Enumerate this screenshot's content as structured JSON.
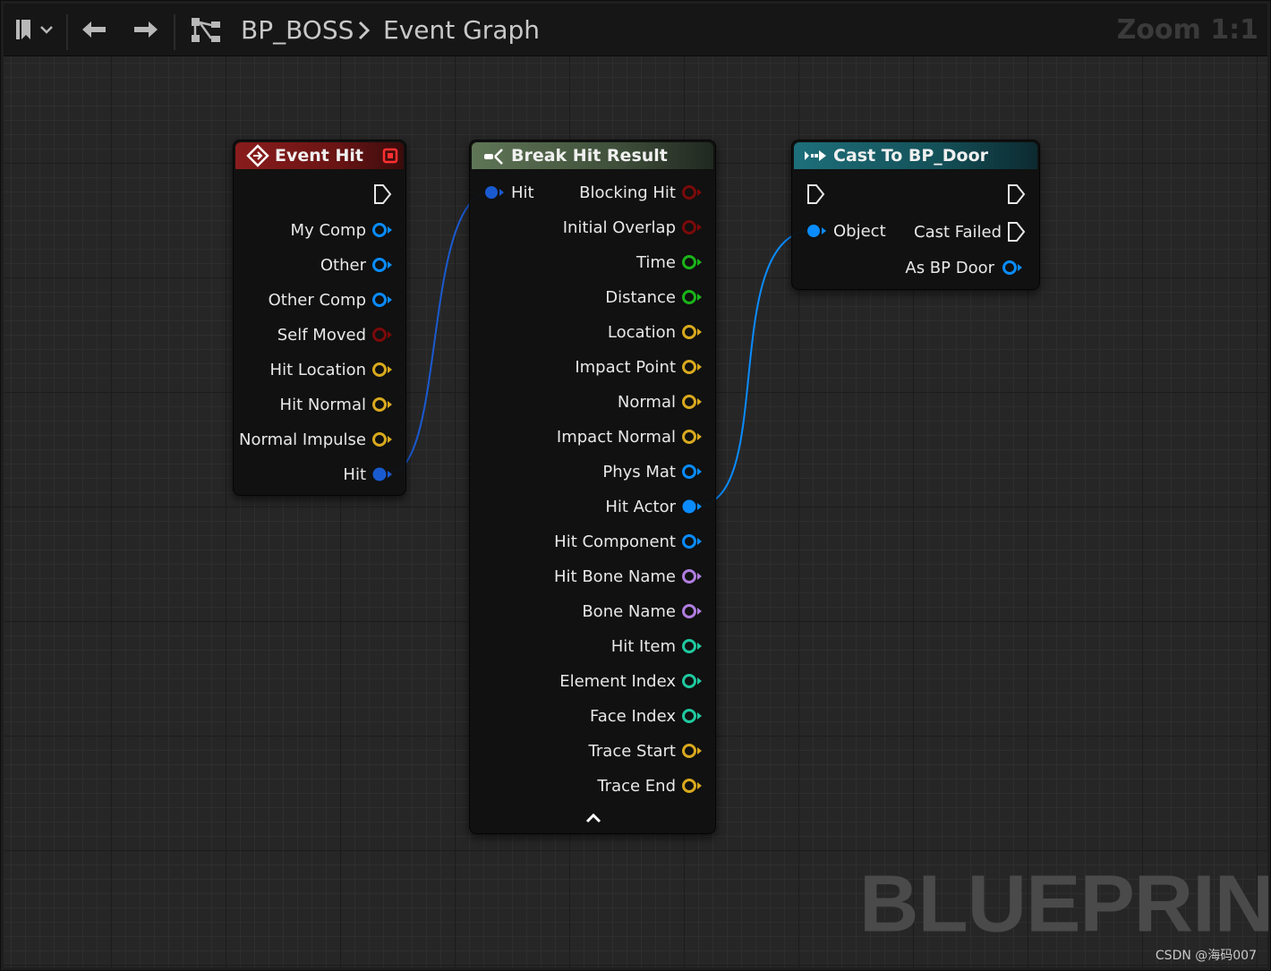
{
  "toolbar": {
    "breadcrumb": [
      "BP_BOSS",
      "Event Graph"
    ],
    "zoom": "Zoom 1:1"
  },
  "watermark": "BLUEPRINT",
  "credit": "CSDN @海码007",
  "colors": {
    "event_header": "#8a1c1c",
    "function_header": "#5f7656",
    "cast_header": "#1d6f7a",
    "object_pin": "#0a8cff",
    "struct_pin": "#1a5ad0",
    "bool_pin": "#7a0a0a",
    "float_pin": "#1ab41a",
    "vector_pin": "#d9a91e",
    "name_pin": "#b07de0",
    "int_pin": "#1fc9a0"
  },
  "nodes": {
    "event_hit": {
      "title": "Event Hit",
      "outputs": [
        "My Comp",
        "Other",
        "Other Comp",
        "Self Moved",
        "Hit Location",
        "Hit Normal",
        "Normal Impulse",
        "Hit"
      ]
    },
    "break_hit_result": {
      "title": "Break Hit Result",
      "input": "Hit",
      "outputs": [
        "Blocking Hit",
        "Initial Overlap",
        "Time",
        "Distance",
        "Location",
        "Impact Point",
        "Normal",
        "Impact Normal",
        "Phys Mat",
        "Hit Actor",
        "Hit Component",
        "Hit Bone Name",
        "Bone Name",
        "Hit Item",
        "Element Index",
        "Face Index",
        "Trace Start",
        "Trace End"
      ]
    },
    "cast_to_bp_door": {
      "title": "Cast To BP_Door",
      "input": "Object",
      "outputs": [
        "Cast Failed",
        "As BP Door"
      ]
    }
  }
}
